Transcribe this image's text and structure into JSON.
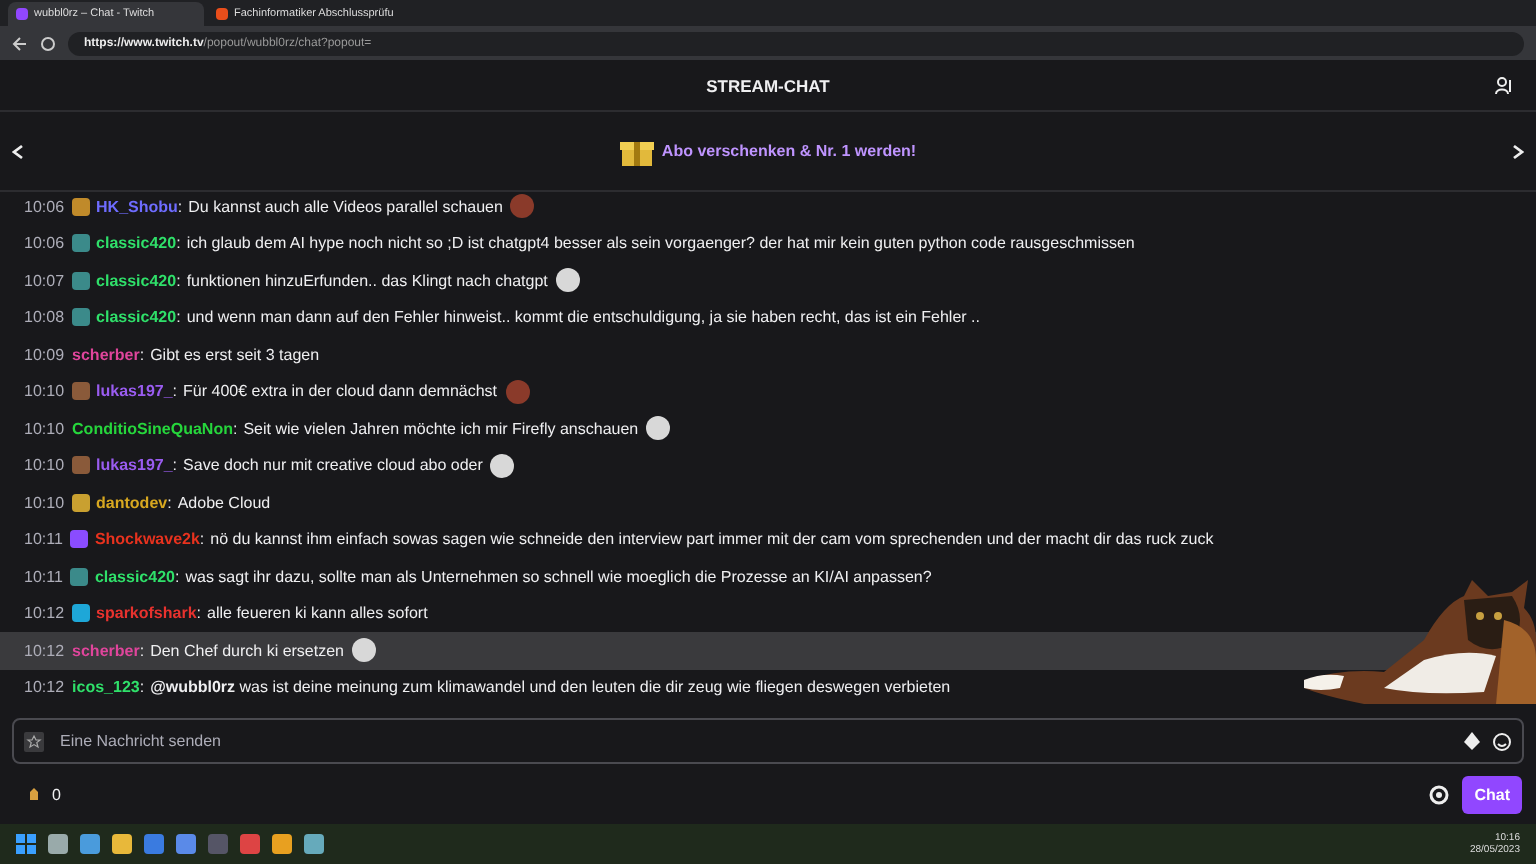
{
  "browser": {
    "tabs": [
      {
        "title": "wubbl0rz – Chat - Twitch",
        "selected": true
      },
      {
        "title": "Fachinformatiker Abschlussprüfu",
        "selected": false
      }
    ],
    "url_host": "https://www.twitch.tv",
    "url_path": "/popout/wubbl0rz/chat?popout="
  },
  "header": {
    "title": "STREAM-CHAT"
  },
  "banner": {
    "text": "Abo verschenken & Nr. 1 werden!"
  },
  "messages": [
    {
      "time": "10:06",
      "user": "HK_Shobu",
      "color": "#6e6cff",
      "badge": {
        "kind": "year"
      },
      "text": "Du kannst auch alle Videos parallel schauen",
      "emote": {
        "kind": "dark"
      },
      "highlighted": false
    },
    {
      "time": "10:06",
      "user": "classic420",
      "color": "#2fe06a",
      "badge": {
        "kind": "leaf"
      },
      "text": "ich glaub dem AI hype noch nicht so ;D ist chatgpt4 besser als sein vorgaenger? der hat mir kein guten python code rausgeschmissen",
      "highlighted": false
    },
    {
      "time": "10:07",
      "user": "classic420",
      "color": "#2fe06a",
      "badge": {
        "kind": "leaf"
      },
      "text": "funktionen hinzuErfunden.. das Klingt nach chatgpt",
      "emote": {
        "kind": "light"
      },
      "highlighted": false
    },
    {
      "time": "10:08",
      "user": "classic420",
      "color": "#2fe06a",
      "badge": {
        "kind": "leaf"
      },
      "text": "und wenn man dann auf den Fehler hinweist.. kommt die entschuldigung, ja sie haben recht, das ist ein Fehler ..",
      "highlighted": false
    },
    {
      "time": "10:09",
      "user": "scherber",
      "color": "#e0459c",
      "text": "Gibt es erst seit 3 tagen",
      "highlighted": false
    },
    {
      "time": "10:10",
      "user": "lukas197_",
      "color": "#9a5cf0",
      "badge": {
        "kind": "block"
      },
      "text": "Für 400€ extra in der cloud dann demnächst",
      "emote": {
        "kind": "dark"
      },
      "highlighted": false
    },
    {
      "time": "10:10",
      "user": "ConditioSineQuaNon",
      "color": "#26d63c",
      "text": "Seit wie vielen Jahren möchte ich mir Firefly anschauen",
      "emote": {
        "kind": "light"
      },
      "highlighted": false
    },
    {
      "time": "10:10",
      "user": "lukas197_",
      "color": "#9a5cf0",
      "badge": {
        "kind": "block"
      },
      "text": "Save doch nur mit creative cloud abo oder",
      "emote": {
        "kind": "light"
      },
      "highlighted": false
    },
    {
      "time": "10:10",
      "user": "dantodev",
      "color": "#d8a820",
      "badge": {
        "kind": "gold"
      },
      "text": "Adobe Cloud",
      "highlighted": false
    },
    {
      "time": "10:11",
      "user": "Shockwave2k",
      "color": "#e8321e",
      "badge": {
        "kind": "verified"
      },
      "text": "nö du kannst ihm einfach sowas sagen wie schneide den interview part immer mit der cam vom sprechenden und der macht dir das ruck zuck",
      "highlighted": false
    },
    {
      "time": "10:11",
      "user": "classic420",
      "color": "#2fe06a",
      "badge": {
        "kind": "leaf"
      },
      "text": "was sagt ihr dazu, sollte man als Unternehmen so schnell wie moeglich die Prozesse an KI/AI anpassen?",
      "highlighted": false
    },
    {
      "time": "10:12",
      "user": "sparkofshark",
      "color": "#e8322e",
      "badge": {
        "kind": "crown"
      },
      "text": "alle feueren ki kann alles sofort",
      "highlighted": false
    },
    {
      "time": "10:12",
      "user": "scherber",
      "color": "#e0459c",
      "text": "Den Chef durch ki ersetzen",
      "emote": {
        "kind": "light"
      },
      "highlighted": true
    },
    {
      "time": "10:12",
      "user": "icos_123",
      "color": "#2fe06a",
      "text": "**@wubbl0rz** was ist deine meinung zum klimawandel und den leuten die dir zeug wie fliegen deswegen verbieten",
      "highlighted": false
    }
  ],
  "separator": ":",
  "input": {
    "placeholder": "Eine Nachricht senden"
  },
  "points": "0",
  "chat_button": "Chat",
  "taskbar": {
    "time": "10:16",
    "date": "28/05/2023"
  }
}
